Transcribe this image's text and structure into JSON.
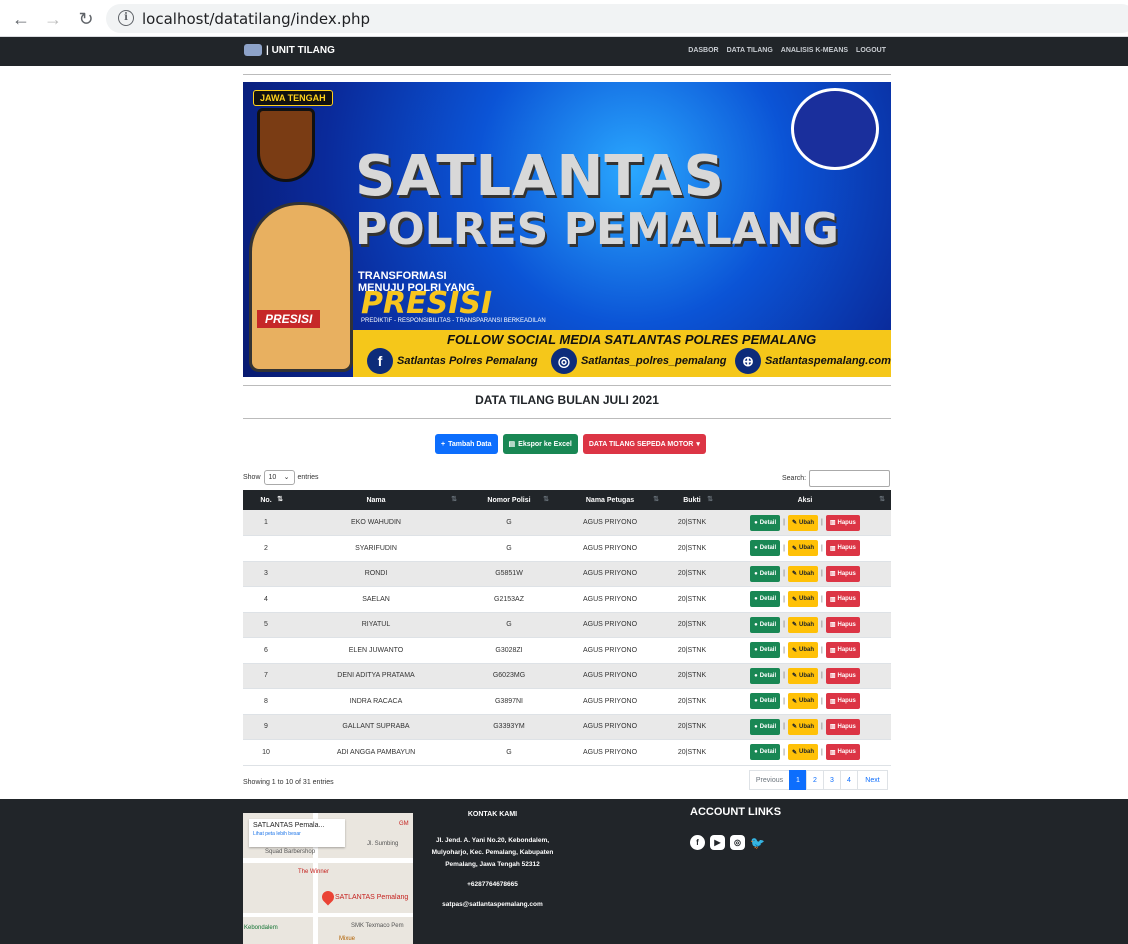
{
  "browser": {
    "url": "localhost/datatilang/index.php",
    "back_icon": "←",
    "forward_icon": "→",
    "reload_icon": "↻",
    "info_icon": "i"
  },
  "navbar": {
    "brand": "| UNIT TILANG",
    "menu": [
      "DASBOR",
      "DATA TILANG",
      "ANALISIS K-MEANS",
      "LOGOUT"
    ]
  },
  "banner": {
    "badge": "JAWA TENGAH",
    "title_line1": "SATLANTAS",
    "title_line2": "POLRES PEMALANG",
    "transformasi": "TRANSFORMASI",
    "menuju": "MENUJU POLRI YANG",
    "presisi": "PRESISI",
    "tagline": "PREDIKTIF - RESPONSIBILITAS - TRANSPARANSI BERKEADILAN",
    "mascot_tag": "PRESISI",
    "follow": "FOLLOW SOCIAL MEDIA SATLANTAS POLRES PEMALANG",
    "facebook": "Satlantas Polres Pemalang",
    "instagram": "Satlantas_polres_pemalang",
    "website": "Satlantaspemalang.com"
  },
  "heading": "DATA TILANG BULAN JULI 2021",
  "buttons": {
    "tambah": "Tambah Data",
    "ekspor": "Ekspor ke Excel",
    "sepeda": "DATA TILANG SEPEDA MOTOR"
  },
  "table_controls": {
    "show": "Show",
    "entries_value": "10",
    "entries": "entries",
    "search": "Search:"
  },
  "table": {
    "headers": [
      "No.",
      "Nama",
      "Nomor Polisi",
      "Nama Petugas",
      "Bukti",
      "Aksi"
    ],
    "rows": [
      {
        "no": "1",
        "nama": "EKO WAHUDIN",
        "nopol": "G",
        "petugas": "AGUS PRIYONO",
        "bukti": "20|STNK"
      },
      {
        "no": "2",
        "nama": "SYARIFUDIN",
        "nopol": "G",
        "petugas": "AGUS PRIYONO",
        "bukti": "20|STNK"
      },
      {
        "no": "3",
        "nama": "RONDI",
        "nopol": "G5851W",
        "petugas": "AGUS PRIYONO",
        "bukti": "20|STNK"
      },
      {
        "no": "4",
        "nama": "SAELAN",
        "nopol": "G2153AZ",
        "petugas": "AGUS PRIYONO",
        "bukti": "20|STNK"
      },
      {
        "no": "5",
        "nama": "RIYATUL",
        "nopol": "G",
        "petugas": "AGUS PRIYONO",
        "bukti": "20|STNK"
      },
      {
        "no": "6",
        "nama": "ELEN JUWANTO",
        "nopol": "G3028ZI",
        "petugas": "AGUS PRIYONO",
        "bukti": "20|STNK"
      },
      {
        "no": "7",
        "nama": "DENI ADITYA PRATAMA",
        "nopol": "G6023MG",
        "petugas": "AGUS PRIYONO",
        "bukti": "20|STNK"
      },
      {
        "no": "8",
        "nama": "INDRA RACACA",
        "nopol": "G3897NI",
        "petugas": "AGUS PRIYONO",
        "bukti": "20|STNK"
      },
      {
        "no": "9",
        "nama": "GALLANT SUPRABA",
        "nopol": "G3393YM",
        "petugas": "AGUS PRIYONO",
        "bukti": "20|STNK"
      },
      {
        "no": "10",
        "nama": "ADI ANGGA PAMBAYUN",
        "nopol": "G",
        "petugas": "AGUS PRIYONO",
        "bukti": "20|STNK"
      }
    ],
    "actions": {
      "detail": "Detail",
      "ubah": "Ubah",
      "hapus": "Hapus"
    }
  },
  "info": "Showing 1 to 10 of 31 entries",
  "pagination": {
    "previous": "Previous",
    "pages": [
      "1",
      "2",
      "3",
      "4"
    ],
    "next": "Next",
    "active": "1"
  },
  "footer": {
    "map_card_title": "SATLANTAS Pemala...",
    "map_card_link": "Lihat peta lebih besar",
    "map_labels": [
      "Squad Barbershop",
      "The Winner",
      "SATLANTAS Pemalang",
      "SMK Texmaco Pem",
      "Kebondalem",
      "Jl. Sumbing",
      "GM",
      "Mixue"
    ],
    "contact_heading": "KONTAK KAMI",
    "address": "Jl. Jend. A. Yani No.20, Kebondalem, Mulyoharjo, Kec. Pemalang, Kabupaten Pemalang, Jawa Tengah 52312",
    "phone": "+6287764678665",
    "email": "satpas@satlantaspemalang.com",
    "account_links": "ACCOUNT LINKS",
    "social_icons": [
      "facebook-icon",
      "youtube-icon",
      "instagram-icon",
      "twitter-icon"
    ]
  }
}
